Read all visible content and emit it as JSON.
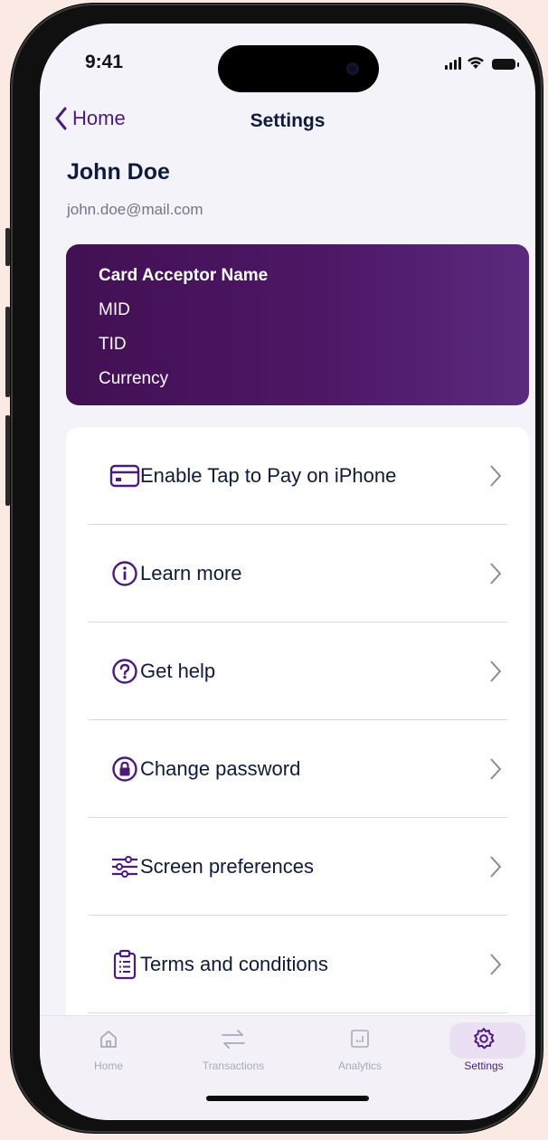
{
  "status_bar": {
    "time": "9:41"
  },
  "nav": {
    "back_label": "Home",
    "title": "Settings"
  },
  "profile": {
    "name": "John Doe",
    "email": "john.doe@mail.com"
  },
  "merchant_card": {
    "lines": [
      "Card Acceptor Name",
      "MID",
      "TID",
      "Currency"
    ]
  },
  "menu": {
    "items": [
      {
        "label": "Enable Tap to Pay on iPhone",
        "icon": "card-icon"
      },
      {
        "label": "Learn more",
        "icon": "info-icon"
      },
      {
        "label": "Get help",
        "icon": "question-icon"
      },
      {
        "label": "Change password",
        "icon": "lock-icon"
      },
      {
        "label": "Screen preferences",
        "icon": "sliders-icon"
      },
      {
        "label": "Terms and conditions",
        "icon": "clipboard-icon"
      }
    ]
  },
  "tab_bar": {
    "tabs": [
      {
        "label": "Home",
        "icon": "home-icon"
      },
      {
        "label": "Transactions",
        "icon": "arrows-icon"
      },
      {
        "label": "Analytics",
        "icon": "chart-icon"
      },
      {
        "label": "Settings",
        "icon": "gear-icon"
      }
    ],
    "active": "Settings"
  },
  "colors": {
    "accent": "#4b1b7a",
    "card_bg": "#4d1765",
    "text": "#101b3a"
  }
}
